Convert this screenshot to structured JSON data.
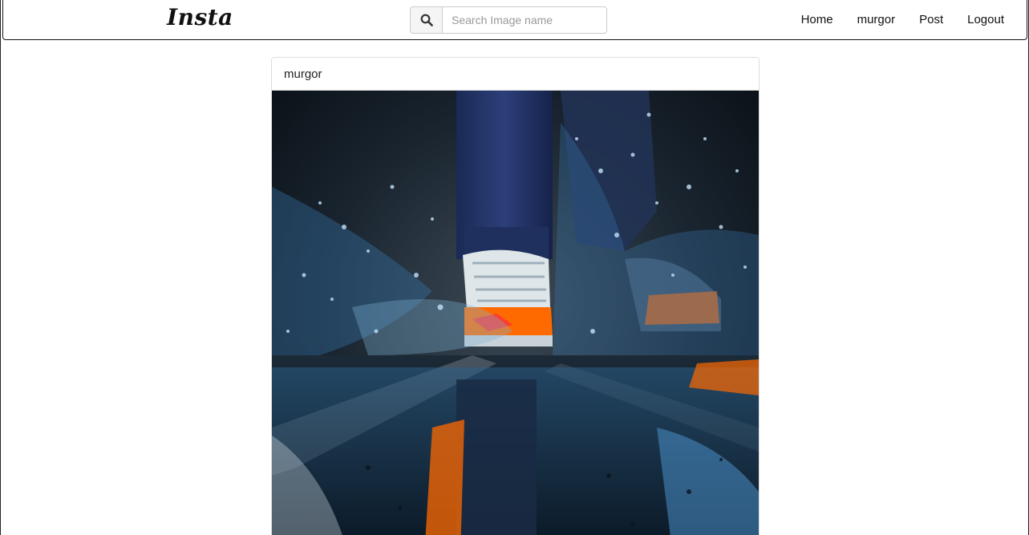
{
  "navbar": {
    "brand": "Insta",
    "search": {
      "placeholder": "Search Image name",
      "value": "",
      "icon": "search-icon"
    },
    "links": [
      {
        "label": "Home"
      },
      {
        "label": "murgor"
      },
      {
        "label": "Post"
      },
      {
        "label": "Logout"
      }
    ]
  },
  "post": {
    "username": "murgor",
    "image_subject": "sneaker-splashing-puddle"
  },
  "colors": {
    "border": "#dddddd",
    "text": "#111111",
    "accent_orange": "#ff6a00",
    "water_blue": "#3a7fb8"
  }
}
